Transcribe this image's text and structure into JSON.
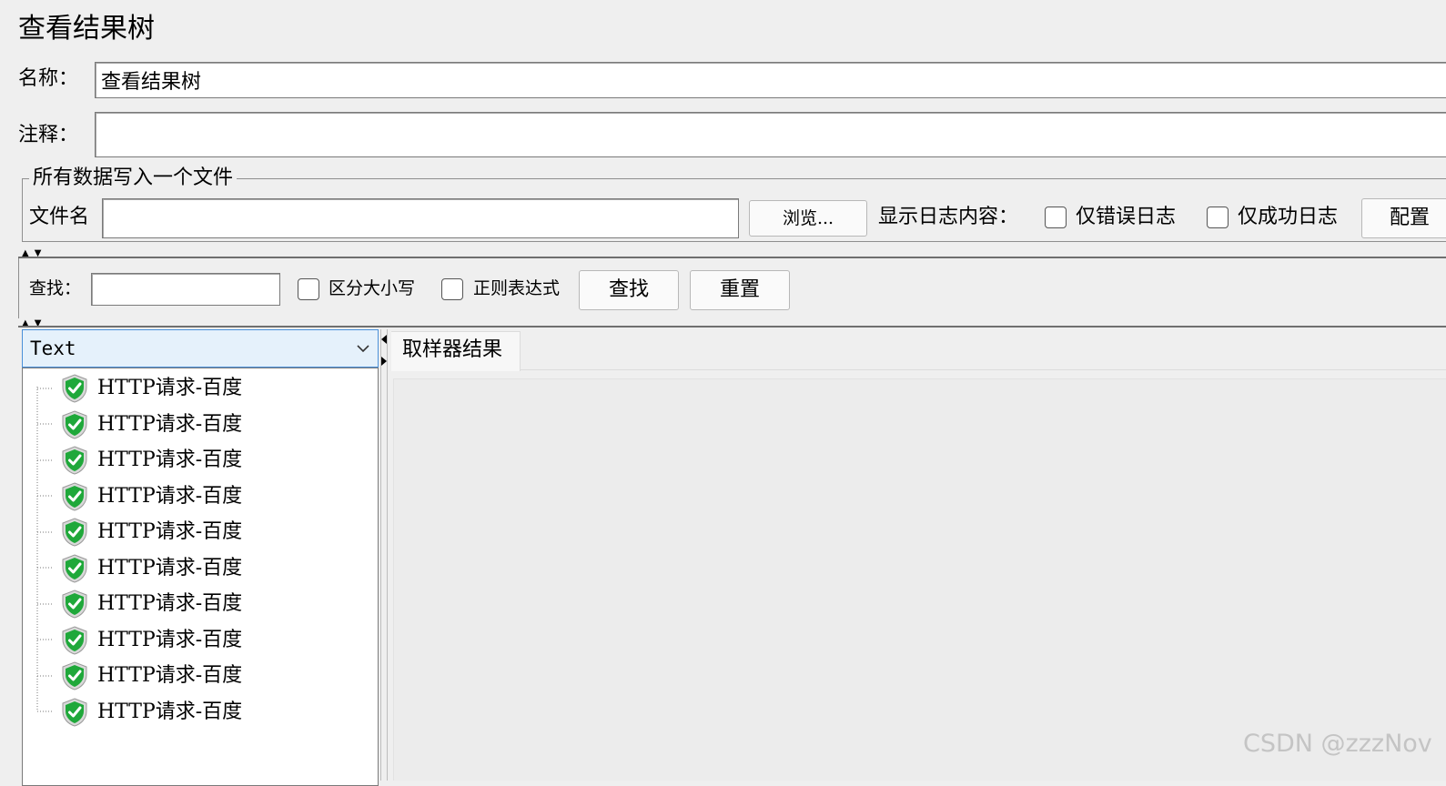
{
  "page": {
    "title": "查看结果树"
  },
  "form": {
    "name_label": "名称：",
    "name_value": "查看结果树",
    "comment_label": "注释：",
    "comment_value": ""
  },
  "file_group": {
    "legend": "所有数据写入一个文件",
    "filename_label": "文件名",
    "filename_value": "",
    "browse_button": "浏览...",
    "log_display_label": "显示日志内容：",
    "errors_only_label": "仅错误日志",
    "errors_only_checked": false,
    "success_only_label": "仅成功日志",
    "success_only_checked": false,
    "configure_button": "配置"
  },
  "search": {
    "label": "查找：",
    "value": "",
    "case_sensitive_label": "区分大小写",
    "case_sensitive_checked": false,
    "regex_label": "正则表达式",
    "regex_checked": false,
    "find_button": "查找",
    "reset_button": "重置"
  },
  "renderer": {
    "selected": "Text"
  },
  "tree": {
    "items": [
      {
        "label": "HTTP请求-百度",
        "status": "success",
        "icon": "success-shield-icon"
      },
      {
        "label": "HTTP请求-百度",
        "status": "success",
        "icon": "success-shield-icon"
      },
      {
        "label": "HTTP请求-百度",
        "status": "success",
        "icon": "success-shield-icon"
      },
      {
        "label": "HTTP请求-百度",
        "status": "success",
        "icon": "success-shield-icon"
      },
      {
        "label": "HTTP请求-百度",
        "status": "success",
        "icon": "success-shield-icon"
      },
      {
        "label": "HTTP请求-百度",
        "status": "success",
        "icon": "success-shield-icon"
      },
      {
        "label": "HTTP请求-百度",
        "status": "success",
        "icon": "success-shield-icon"
      },
      {
        "label": "HTTP请求-百度",
        "status": "success",
        "icon": "success-shield-icon"
      },
      {
        "label": "HTTP请求-百度",
        "status": "success",
        "icon": "success-shield-icon"
      },
      {
        "label": "HTTP请求-百度",
        "status": "success",
        "icon": "success-shield-icon"
      }
    ]
  },
  "result_tabs": [
    {
      "label": "取样器结果",
      "active": true
    }
  ],
  "watermark": "CSDN @zzzNov",
  "colors": {
    "success_green": "#1fa83a",
    "combo_bg": "#e5f1fb",
    "combo_border": "#4a90d9"
  }
}
